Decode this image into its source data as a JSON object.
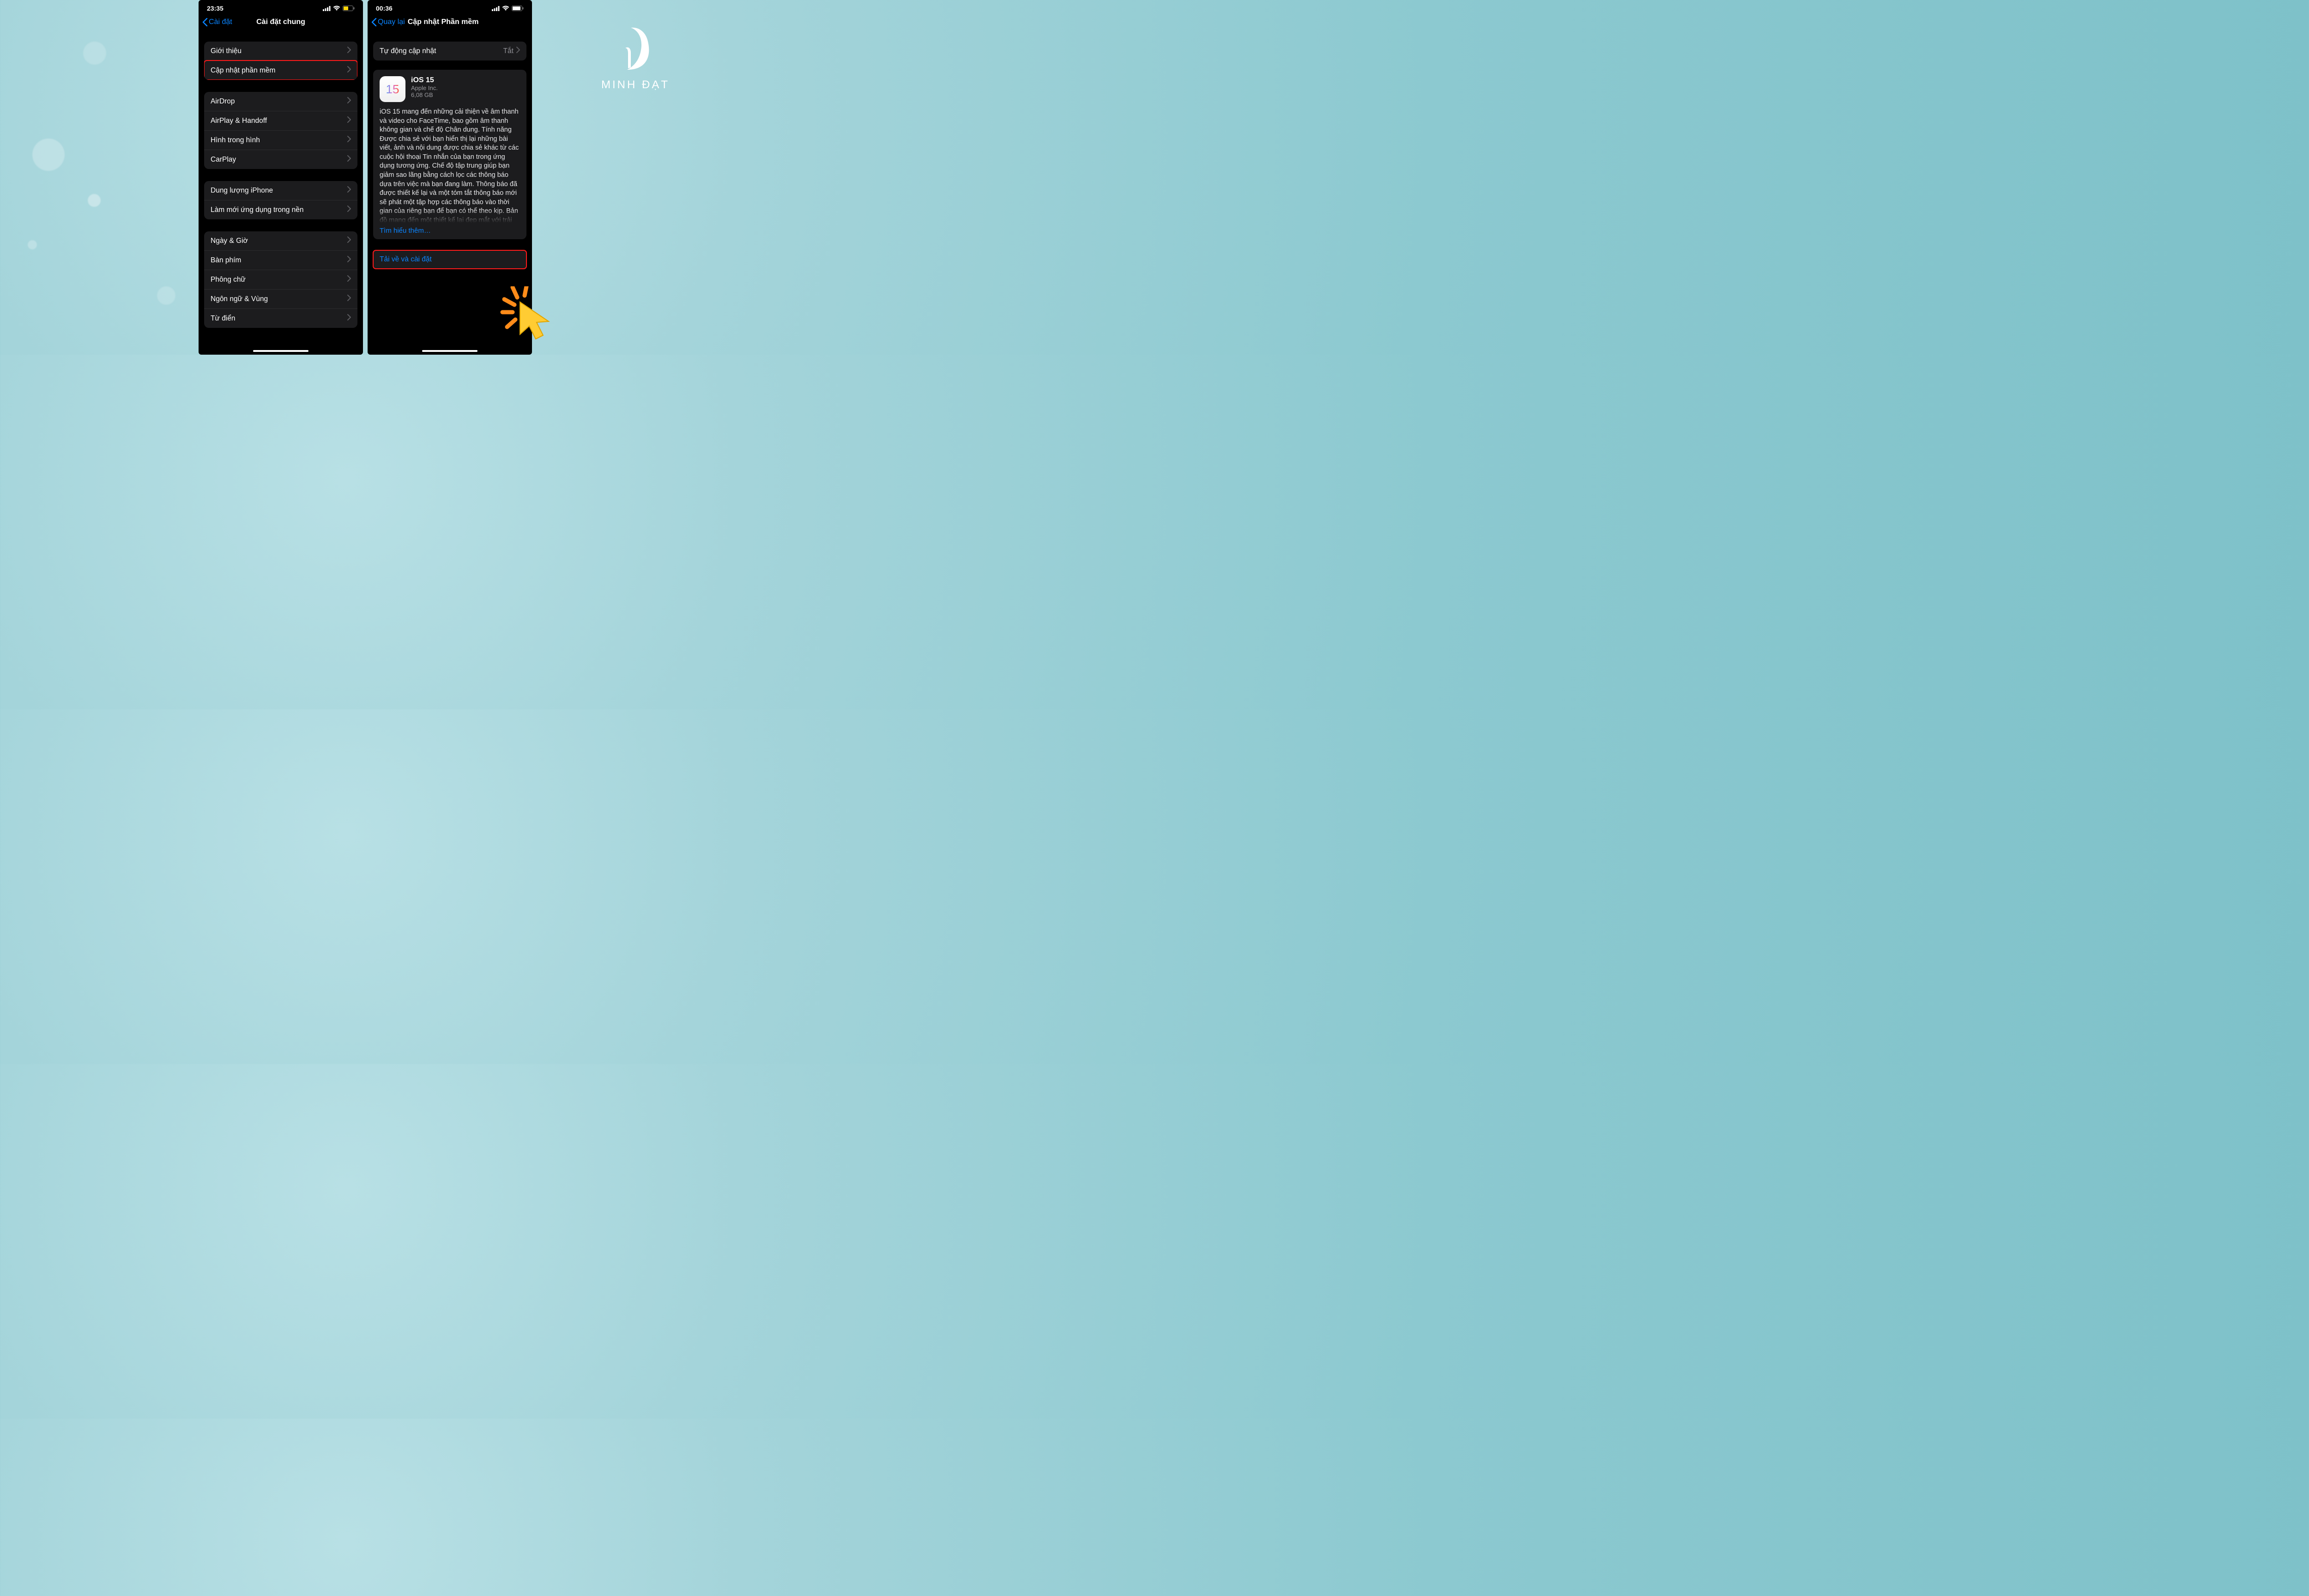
{
  "brand": {
    "name": "MINH ĐẠT"
  },
  "phone1": {
    "status": {
      "time": "23:35"
    },
    "nav": {
      "back": "Cài đặt",
      "title": "Cài đặt chung"
    },
    "groups": [
      {
        "rows": [
          {
            "label": "Giới thiệu"
          },
          {
            "label": "Cập nhật phần mềm",
            "highlight": true
          }
        ]
      },
      {
        "rows": [
          {
            "label": "AirDrop"
          },
          {
            "label": "AirPlay & Handoff"
          },
          {
            "label": "Hình trong hình"
          },
          {
            "label": "CarPlay"
          }
        ]
      },
      {
        "rows": [
          {
            "label": "Dung lượng iPhone"
          },
          {
            "label": "Làm mới ứng dụng trong nền"
          }
        ]
      },
      {
        "rows": [
          {
            "label": "Ngày & Giờ"
          },
          {
            "label": "Bàn phím"
          },
          {
            "label": "Phông chữ"
          },
          {
            "label": "Ngôn ngữ & Vùng"
          },
          {
            "label": "Từ điển"
          }
        ]
      }
    ]
  },
  "phone2": {
    "status": {
      "time": "00:36"
    },
    "nav": {
      "back": "Quay lại",
      "title": "Cập nhật Phần mềm"
    },
    "auto_update": {
      "label": "Tự động cập nhật",
      "value": "Tắt"
    },
    "update": {
      "icon_text": "15",
      "title": "iOS 15",
      "vendor": "Apple Inc.",
      "size": "6,08 GB",
      "description": "iOS 15 mang đến những cải thiện về âm thanh và video cho FaceTime, bao gồm âm thanh không gian và chế độ Chân dung. Tính năng Được chia sẻ với bạn hiển thị lại những bài viết, ảnh và nội dung được chia sẻ khác từ các cuộc hội thoại Tin nhắn của bạn trong ứng dụng tương ứng. Chế độ tập trung giúp bạn giảm sao lãng bằng cách lọc các thông báo dựa trên việc mà bạn đang làm. Thông báo đã được thiết kế lại và một tóm tắt thông báo mới sẽ phát một tập hợp các thông báo vào thời gian của riêng bạn để bạn có thể theo kịp. Bản đồ mang đến một thiết kế lại đẹp mắt với trải",
      "learn_more": "Tìm hiểu thêm…"
    },
    "download_label": "Tải về và cài đặt"
  }
}
